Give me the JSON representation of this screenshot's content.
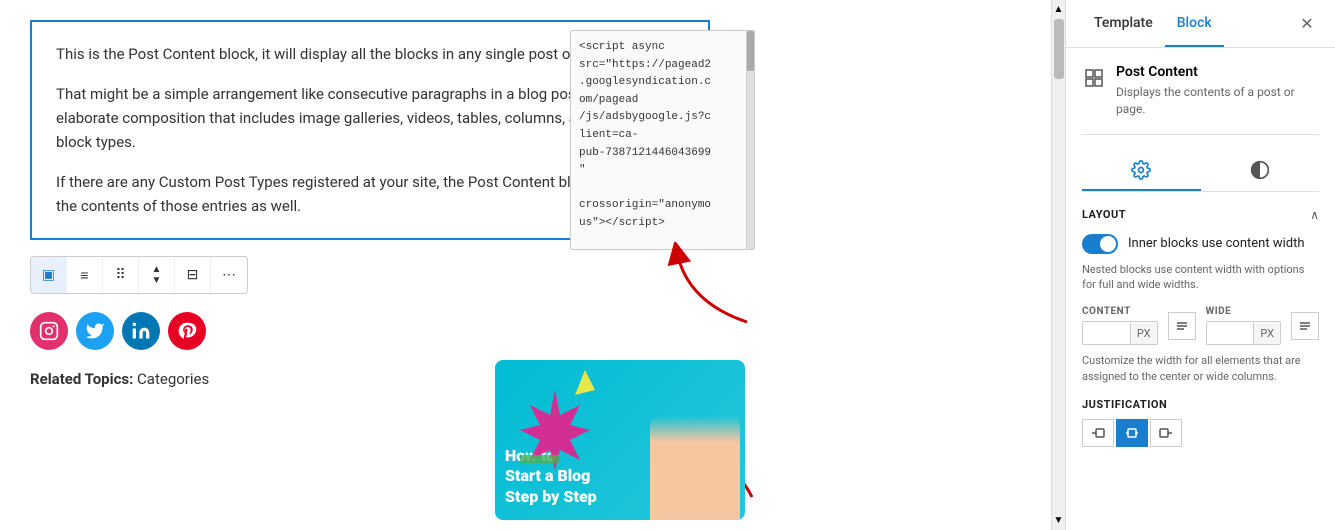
{
  "sidebar": {
    "tabs": [
      {
        "id": "template",
        "label": "Template",
        "active": false
      },
      {
        "id": "block",
        "label": "Block",
        "active": true
      }
    ],
    "close_label": "✕",
    "block_info": {
      "title": "Post Content",
      "description": "Displays the contents of a post or page."
    },
    "settings_tabs": [
      {
        "id": "gear",
        "icon": "⚙",
        "active": true
      },
      {
        "id": "contrast",
        "icon": "◑",
        "active": false
      }
    ],
    "layout": {
      "section_title": "Layout",
      "toggle_label": "Inner blocks use content width",
      "toggle_description": "Nested blocks use content width with options for full and wide widths.",
      "toggle_on": true,
      "content_label": "CONTENT",
      "wide_label": "WIDE",
      "content_value": "",
      "wide_value": "",
      "unit": "PX",
      "width_description": "Customize the width for all elements that are assigned to the center or wide columns.",
      "justification_label": "JUSTIFICATION",
      "just_options": [
        {
          "id": "left",
          "icon": "◄─",
          "active": false
        },
        {
          "id": "center",
          "icon": "+",
          "active": true
        },
        {
          "id": "right",
          "icon": "─►",
          "active": false
        }
      ]
    }
  },
  "editor": {
    "post_content_paragraphs": [
      "This is the Post Content block, it will display all the blocks in any single post or page.",
      "That might be a simple arrangement like consecutive paragraphs in a blog post, or a more elaborate composition that includes image galleries, videos, tables, columns, and any other block types.",
      "If there are any Custom Post Types registered at your site, the Post Content block can display the contents of those entries as well."
    ],
    "toolbar_items": [
      {
        "id": "layout-icon",
        "icon": "▣",
        "selected": true
      },
      {
        "id": "align-left",
        "icon": "≡"
      },
      {
        "id": "dots-grid",
        "icon": "⠿"
      },
      {
        "id": "arrows",
        "icon": "⇅"
      },
      {
        "id": "align-center-icon",
        "icon": "⊟"
      },
      {
        "id": "more",
        "icon": "⋯"
      }
    ],
    "social_icons": [
      {
        "id": "instagram",
        "class": "instagram",
        "letter": "📷"
      },
      {
        "id": "twitter",
        "class": "twitter",
        "letter": "🐦"
      },
      {
        "id": "linkedin",
        "class": "linkedin",
        "letter": "in"
      },
      {
        "id": "pinterest",
        "class": "pinterest",
        "letter": "P"
      }
    ],
    "related_topics_label": "Related Topics:",
    "related_topics_value": "Categories",
    "blog_card_text": "How to\nStart a Blog\nStep by Step",
    "code_content": "<script async\nsrc=\"https://pagead2\n.googlesyndication.c\nom/pagead\n/js/adsbygoogle.js?c\nlient=ca-\npub-7387121446043699\n\"\n\ncrossorigin=\"anonymo\nus\"></script>"
  }
}
